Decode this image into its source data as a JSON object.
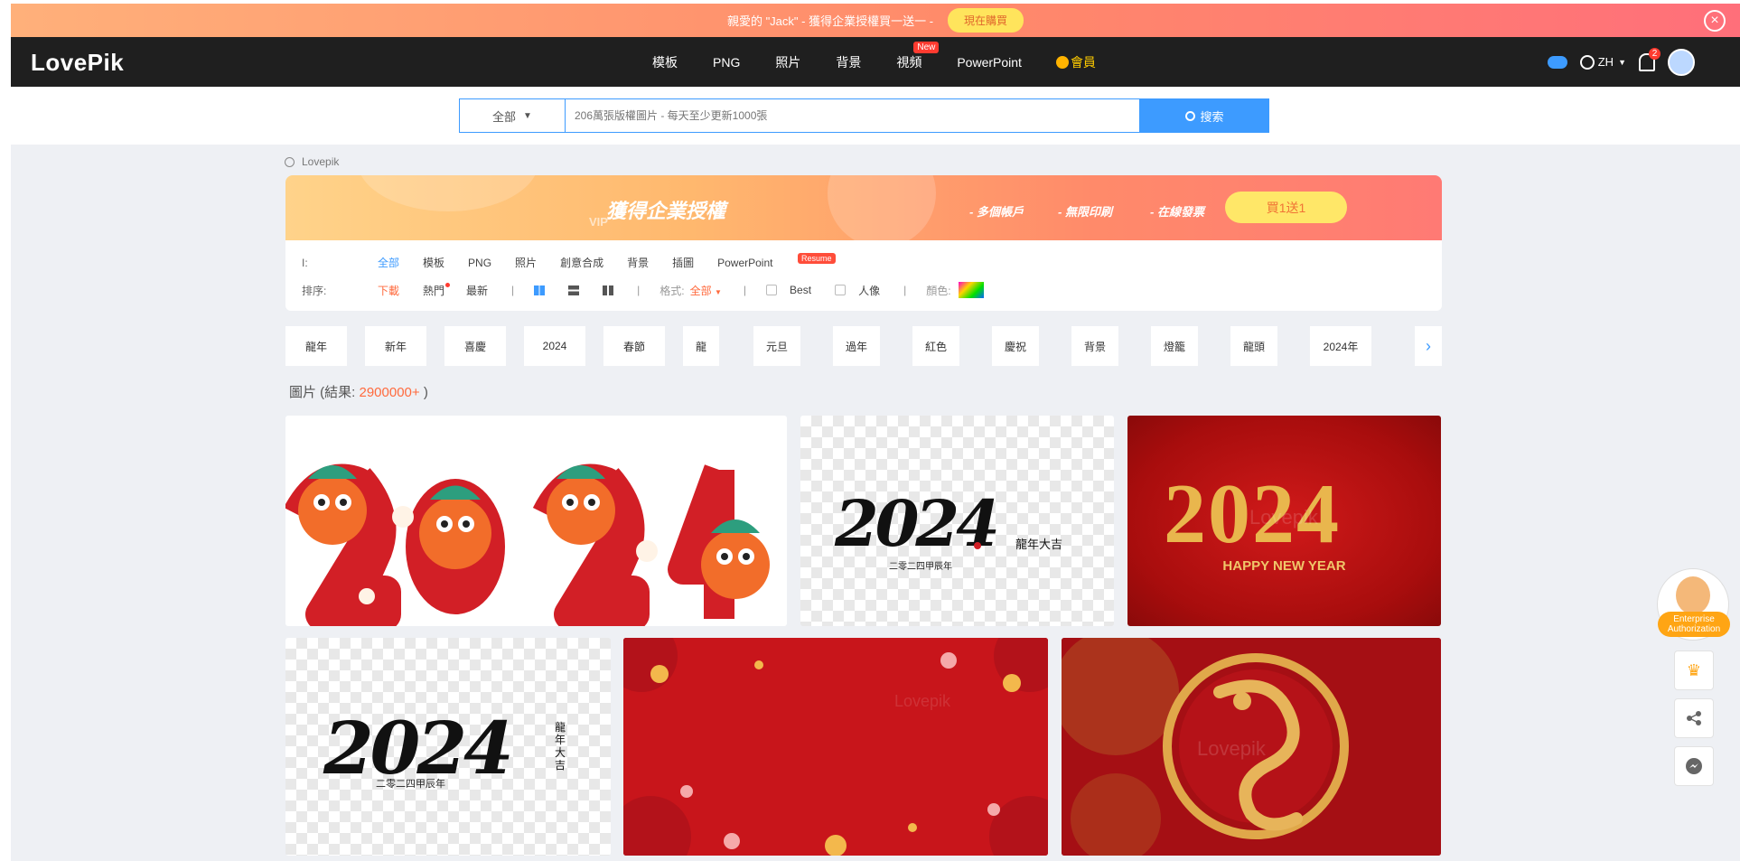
{
  "promo": {
    "message": "親愛的 \"Jack\" - 獲得企業授權買一送一 -",
    "button": "現在購買",
    "close_icon": "close-icon"
  },
  "nav": {
    "logo": "LovePik",
    "items": [
      "模板",
      "PNG",
      "照片",
      "背景",
      "視頻",
      "PowerPoint"
    ],
    "new_badge": "New",
    "vip_label": "會員",
    "lang": "ZH",
    "notification_count": "2"
  },
  "search": {
    "category": "全部",
    "placeholder": "206萬張版權圖片 - 每天至少更新1000張",
    "button": "搜索"
  },
  "breadcrumb": "Lovepik",
  "banner": {
    "title": "獲得企業授權",
    "vip": "VIP",
    "features": [
      "- 多個帳戶",
      "- 無限印刷",
      "- 在線發票"
    ],
    "button": "買1送1"
  },
  "filters": {
    "type_label": "I:",
    "types": [
      "全部",
      "模板",
      "PNG",
      "照片",
      "創意合成",
      "背景",
      "插圖",
      "PowerPoint"
    ],
    "resume_badge": "Resume",
    "sort_label": "排序:",
    "sorts": [
      "下載",
      "熱門",
      "最新"
    ],
    "format_label": "格式:",
    "format_value": "全部",
    "best_label": "Best",
    "people_label": "人像",
    "color_label": "顏色:"
  },
  "tags": [
    "龍年",
    "新年",
    "喜慶",
    "2024",
    "春節",
    "龍",
    "元旦",
    "過年",
    "紅色",
    "慶祝",
    "背景",
    "燈籠",
    "龍頭",
    "2024年"
  ],
  "results": {
    "prefix": "圖片 (結果: ",
    "count": "2900000+",
    "suffix": " )"
  },
  "cards": {
    "card2_calligraphy": "2024",
    "card2_sub": "龍年大吉",
    "card2_bottom": "二零二四甲辰年",
    "card3_number": "2024",
    "card3_text": "HAPPY NEW YEAR",
    "card4_calligraphy": "2024",
    "card4_side": "龍年大吉",
    "card4_bottom": "二零二四甲辰年",
    "watermark": "Lovepik"
  },
  "floating": {
    "enterprise_label": "Enterprise Authorization"
  },
  "colors": {
    "accent_blue": "#3d9bff",
    "accent_orange": "#ff6a3d",
    "nav_bg": "#1f1f1f",
    "page_bg": "#eef0f4"
  }
}
